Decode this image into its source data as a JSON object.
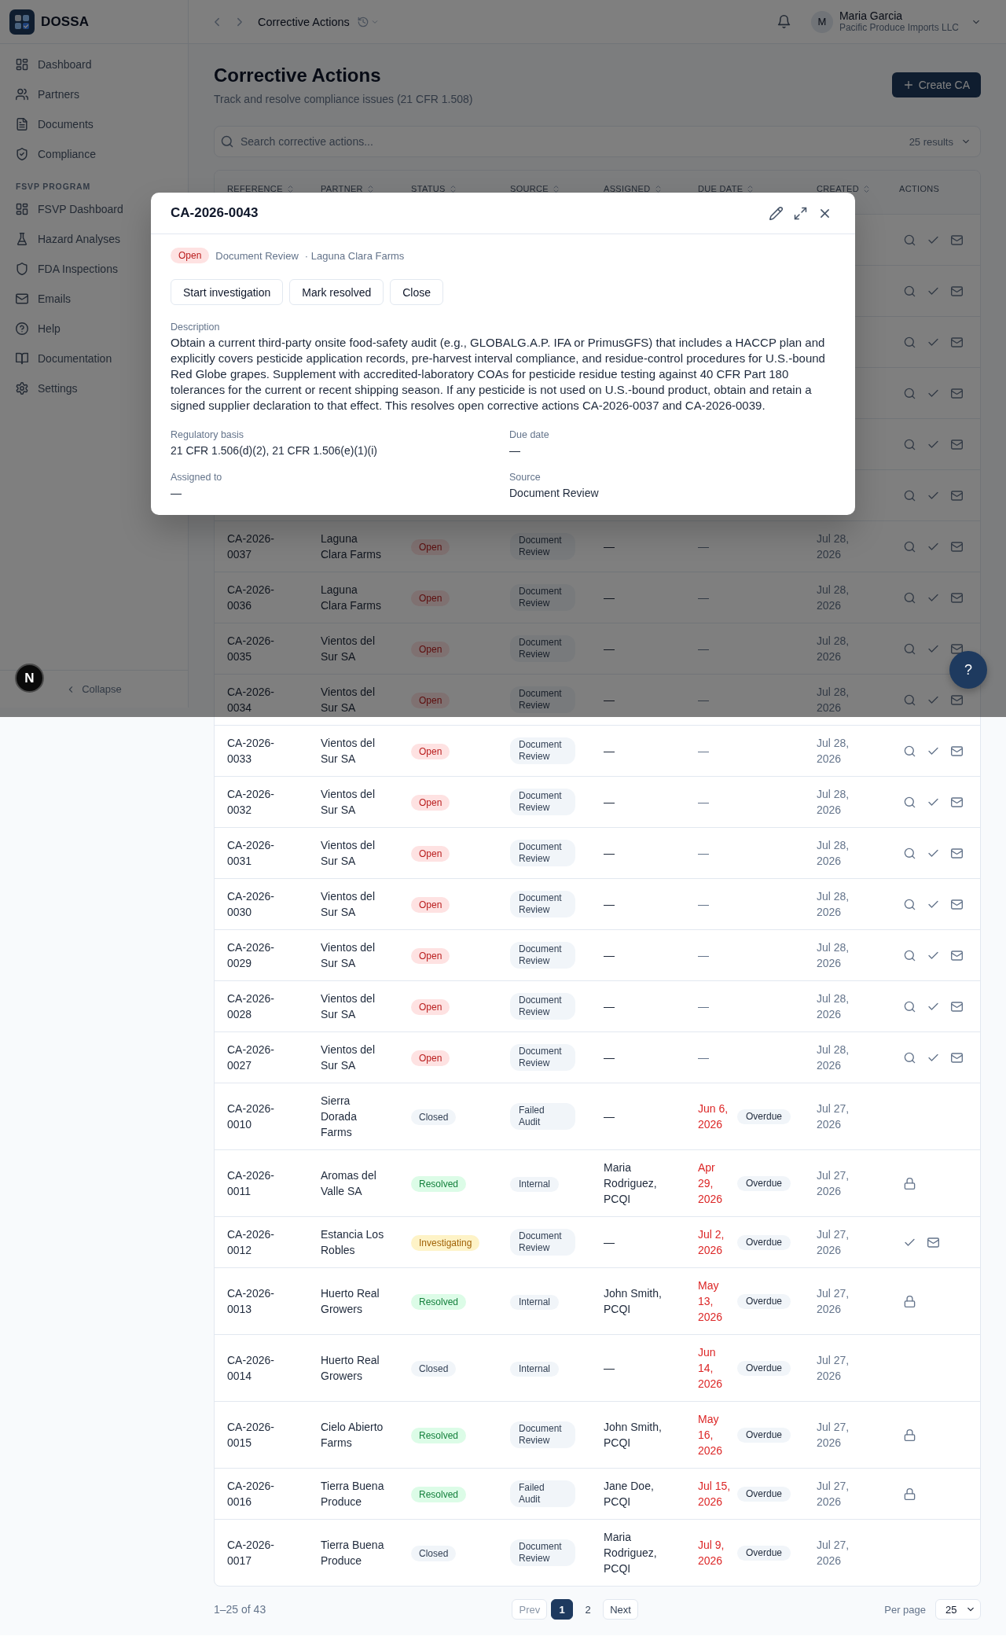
{
  "sidebar": {
    "brand": "DOSSA",
    "sections": [
      {
        "items": [
          {
            "label": "Dashboard",
            "selected": false
          },
          {
            "label": "Partners",
            "selected": false
          },
          {
            "label": "Documents",
            "selected": false
          },
          {
            "label": "Compliance",
            "selected": false
          }
        ]
      },
      {
        "title": "FSVP PROGRAM",
        "items": [
          {
            "label": "FSVP Dashboard",
            "selected": false
          },
          {
            "label": "Hazard Analyses",
            "selected": false
          },
          {
            "label": "FDA Inspections",
            "selected": false
          },
          {
            "label": "Emails",
            "selected": false
          },
          {
            "label": "Help",
            "selected": false
          },
          {
            "label": "Documentation",
            "selected": false
          },
          {
            "label": "Settings",
            "selected": false
          }
        ]
      }
    ],
    "collapse": "Collapse"
  },
  "topbar": {
    "title": "Corrective Actions",
    "user": {
      "initial": "M",
      "name": "Maria Garcia",
      "organization": "Pacific Produce Imports LLC"
    }
  },
  "page": {
    "title": "Corrective Actions",
    "subtitle": "Track and resolve compliance issues (21 CFR 1.508)",
    "create_button": "Create CA"
  },
  "search": {
    "placeholder": "Search corrective actions...",
    "results": "25 results"
  },
  "table": {
    "columns": [
      {
        "label": "REFERENCE",
        "sortable": true
      },
      {
        "label": "PARTNER",
        "sortable": true
      },
      {
        "label": "STATUS",
        "sortable": true
      },
      {
        "label": "SOURCE",
        "sortable": true
      },
      {
        "label": "ASSIGNED",
        "sortable": true
      },
      {
        "label": "DUE DATE",
        "sortable": true
      },
      {
        "label": "CREATED",
        "sortable": true
      },
      {
        "label": "ACTIONS",
        "sortable": false
      }
    ],
    "rows": [
      {
        "kind": "full"
      },
      {
        "kind": "full"
      },
      {
        "kind": "full"
      },
      {
        "kind": "full"
      },
      {
        "kind": "full"
      },
      {
        "kind": "full"
      },
      {
        "kind": "full",
        "reference": "CA-2026-0037",
        "partner": "Laguna Clara Farms",
        "status": {
          "label": "Open",
          "kind": "open"
        },
        "source": "Document Review",
        "assigned": "—",
        "due": "—",
        "overdue": false,
        "created": "Jul 28, 2026"
      },
      {
        "kind": "full",
        "reference": "CA-2026-0036",
        "partner": "Laguna Clara Farms",
        "status": {
          "label": "Open",
          "kind": "open"
        },
        "source": "Document Review",
        "assigned": "—",
        "due": "—",
        "overdue": false,
        "created": "Jul 28, 2026"
      },
      {
        "kind": "full",
        "reference": "CA-2026-0035",
        "partner": "Vientos del Sur SA",
        "status": {
          "label": "Open",
          "kind": "open"
        },
        "source": "Document Review",
        "assigned": "—",
        "due": "—",
        "overdue": false,
        "created": "Jul 28, 2026"
      },
      {
        "kind": "full",
        "reference": "CA-2026-0034",
        "partner": "Vientos del Sur SA",
        "status": {
          "label": "Open",
          "kind": "open"
        },
        "source": "Document Review",
        "assigned": "—",
        "due": "—",
        "overdue": false,
        "created": "Jul 28, 2026"
      },
      {
        "kind": "full",
        "reference": "CA-2026-0033",
        "partner": "Vientos del Sur SA",
        "status": {
          "label": "Open",
          "kind": "open"
        },
        "source": "Document Review",
        "assigned": "—",
        "due": "—",
        "overdue": false,
        "created": "Jul 28, 2026"
      },
      {
        "kind": "full",
        "reference": "CA-2026-0032",
        "partner": "Vientos del Sur SA",
        "status": {
          "label": "Open",
          "kind": "open"
        },
        "source": "Document Review",
        "assigned": "—",
        "due": "—",
        "overdue": false,
        "created": "Jul 28, 2026"
      },
      {
        "kind": "full",
        "reference": "CA-2026-0031",
        "partner": "Vientos del Sur SA",
        "status": {
          "label": "Open",
          "kind": "open"
        },
        "source": "Document Review",
        "assigned": "—",
        "due": "—",
        "overdue": false,
        "created": "Jul 28, 2026"
      },
      {
        "kind": "full",
        "reference": "CA-2026-0030",
        "partner": "Vientos del Sur SA",
        "status": {
          "label": "Open",
          "kind": "open"
        },
        "source": "Document Review",
        "assigned": "—",
        "due": "—",
        "overdue": false,
        "created": "Jul 28, 2026"
      },
      {
        "kind": "full",
        "reference": "CA-2026-0029",
        "partner": "Vientos del Sur SA",
        "status": {
          "label": "Open",
          "kind": "open"
        },
        "source": "Document Review",
        "assigned": "—",
        "due": "—",
        "overdue": false,
        "created": "Jul 28, 2026"
      },
      {
        "kind": "full",
        "reference": "CA-2026-0028",
        "partner": "Vientos del Sur SA",
        "status": {
          "label": "Open",
          "kind": "open"
        },
        "source": "Document Review",
        "assigned": "—",
        "due": "—",
        "overdue": false,
        "created": "Jul 28, 2026"
      },
      {
        "kind": "full",
        "reference": "CA-2026-0027",
        "partner": "Vientos del Sur SA",
        "status": {
          "label": "Open",
          "kind": "open"
        },
        "source": "Document Review",
        "assigned": "—",
        "due": "—",
        "overdue": false,
        "created": "Jul 28, 2026"
      },
      {
        "kind": "plain",
        "reference": "CA-2026-0010",
        "partner": "Sierra Dorada Farms",
        "status": {
          "label": "Closed",
          "kind": "closed"
        },
        "source": "Failed Audit",
        "assigned": "—",
        "due": "Jun 6, 2026",
        "overdue": true,
        "overdue_label": "Overdue",
        "created": "Jul 27, 2026"
      },
      {
        "kind": "locked",
        "reference": "CA-2026-0011",
        "partner": "Aromas del Valle SA",
        "status": {
          "label": "Resolved",
          "kind": "resolved"
        },
        "source": "Internal",
        "assigned": "Maria Rodriguez, PCQI",
        "due": "Apr 29, 2026",
        "overdue": true,
        "overdue_label": "Overdue",
        "created": "Jul 27, 2026"
      },
      {
        "kind": "partial",
        "reference": "CA-2026-0012",
        "partner": "Estancia Los Robles",
        "status": {
          "label": "Investigating",
          "kind": "investigating"
        },
        "source": "Document Review",
        "assigned": "—",
        "due": "Jul 2, 2026",
        "overdue": true,
        "overdue_label": "Overdue",
        "created": "Jul 27, 2026"
      },
      {
        "kind": "locked",
        "reference": "CA-2026-0013",
        "partner": "Huerto Real Growers",
        "status": {
          "label": "Resolved",
          "kind": "resolved"
        },
        "source": "Internal",
        "assigned": "John Smith, PCQI",
        "due": "May 13, 2026",
        "overdue": true,
        "overdue_label": "Overdue",
        "created": "Jul 27, 2026"
      },
      {
        "kind": "plain",
        "reference": "CA-2026-0014",
        "partner": "Huerto Real Growers",
        "status": {
          "label": "Closed",
          "kind": "closed"
        },
        "source": "Internal",
        "assigned": "—",
        "due": "Jun 14, 2026",
        "overdue": true,
        "overdue_label": "Overdue",
        "created": "Jul 27, 2026"
      },
      {
        "kind": "locked",
        "reference": "CA-2026-0015",
        "partner": "Cielo Abierto Farms",
        "status": {
          "label": "Resolved",
          "kind": "resolved"
        },
        "source": "Document Review",
        "assigned": "John Smith, PCQI",
        "due": "May 16, 2026",
        "overdue": true,
        "overdue_label": "Overdue",
        "created": "Jul 27, 2026"
      },
      {
        "kind": "locked",
        "reference": "CA-2026-0016",
        "partner": "Tierra Buena Produce",
        "status": {
          "label": "Resolved",
          "kind": "resolved"
        },
        "source": "Failed Audit",
        "assigned": "Jane Doe, PCQI",
        "due": "Jul 15, 2026",
        "overdue": true,
        "overdue_label": "Overdue",
        "created": "Jul 27, 2026"
      },
      {
        "kind": "plain",
        "reference": "CA-2026-0017",
        "partner": "Tierra Buena Produce",
        "status": {
          "label": "Closed",
          "kind": "closed"
        },
        "source": "Document Review",
        "assigned": "Maria Rodriguez, PCQI",
        "due": "Jul 9, 2026",
        "overdue": true,
        "overdue_label": "Overdue",
        "created": "Jul 27, 2026"
      }
    ]
  },
  "pagination": {
    "summary": "1–25 of 43",
    "prev": {
      "label": "Prev",
      "disabled": true
    },
    "pages": [
      {
        "label": "1",
        "selected": true
      },
      {
        "label": "2",
        "selected": false
      }
    ],
    "next": {
      "label": "Next",
      "disabled": false
    },
    "per_page_label": "Per page",
    "per_page": "25"
  },
  "modal": {
    "title": "CA-2026-0043",
    "status": {
      "label": "Open",
      "kind": "open"
    },
    "source": "Document Review",
    "partner": "· Laguna Clara Farms",
    "buttons": [
      "Start investigation",
      "Mark resolved",
      "Close"
    ],
    "description_label": "Description",
    "description": "Obtain a current third-party onsite food-safety audit (e.g., GLOBALG.A.P. IFA or PrimusGFS) that includes a HACCP plan and explicitly covers pesticide application records, pre-harvest interval compliance, and residue-control procedures for U.S.-bound Red Globe grapes. Supplement with accredited-laboratory COAs for pesticide residue testing against 40 CFR Part 180 tolerances for the current or recent shipping season. If any pesticide is not used on U.S.-bound product, obtain and retain a signed supplier declaration to that effect. This resolves open corrective actions CA-2026-0037 and CA-2026-0039.",
    "fields": [
      {
        "label": "Regulatory basis",
        "value": "21 CFR 1.506(d)(2), 21 CFR 1.506(e)(1)(i)"
      },
      {
        "label": "Due date",
        "value": "—"
      },
      {
        "label": "Assigned to",
        "value": "—"
      },
      {
        "label": "Source",
        "value": "Document Review"
      }
    ]
  },
  "help_button": "?",
  "logo_button": "N"
}
